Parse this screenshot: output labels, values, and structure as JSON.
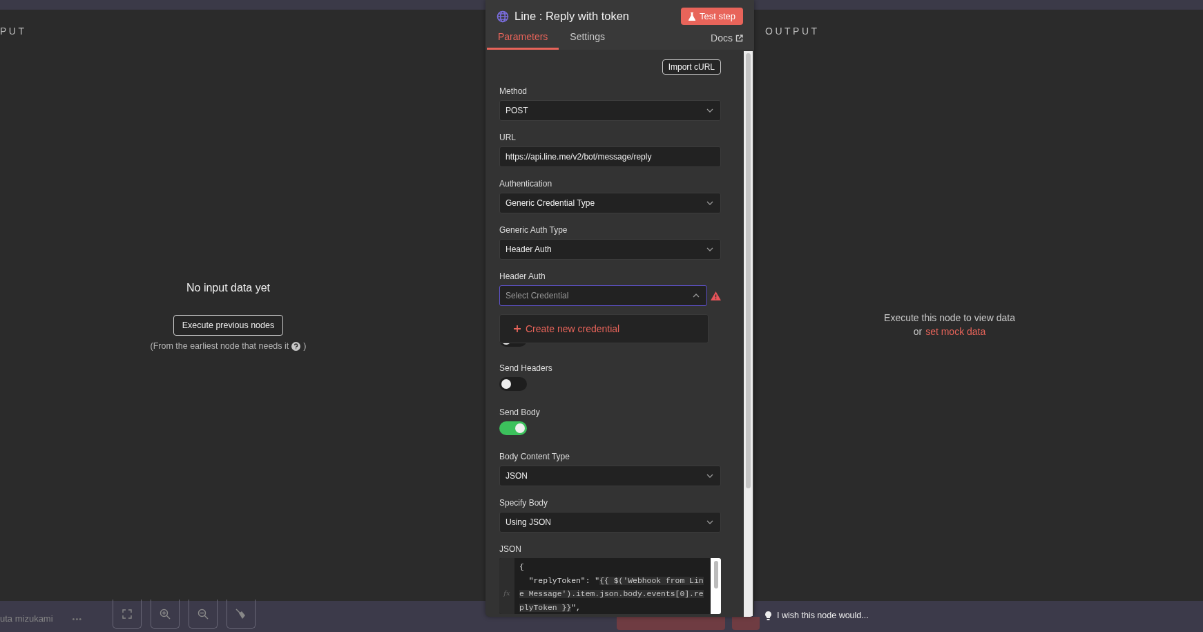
{
  "input_pane": {
    "title": "PUT",
    "message": "No input data yet",
    "button": "Execute previous nodes",
    "hint": "(From the earliest node that needs it",
    "hint_end": ")"
  },
  "node_panel": {
    "title": "Line : Reply with token",
    "test_button": "Test step",
    "tabs": [
      {
        "label": "Parameters",
        "selected": true
      },
      {
        "label": "Settings",
        "selected": false
      }
    ],
    "docs_link": "Docs",
    "import_button": "Import cURL",
    "fields": [
      {
        "kind": "select",
        "label": "Method",
        "value": "POST"
      },
      {
        "kind": "text",
        "label": "URL",
        "value": "https://api.line.me/v2/bot/message/reply"
      },
      {
        "kind": "select",
        "label": "Authentication",
        "value": "Generic Credential Type"
      },
      {
        "kind": "select",
        "label": "Generic Auth Type",
        "value": "Header Auth"
      },
      {
        "kind": "credential",
        "label": "Header Auth",
        "placeholder": "Select Credential",
        "expanded": true,
        "warning": true,
        "menu_item": "Create new credential"
      },
      {
        "kind": "toggle",
        "on": false
      },
      {
        "kind": "toggle",
        "label": "Send Headers",
        "on": false
      },
      {
        "kind": "toggle",
        "label": "Send Body",
        "on": true
      },
      {
        "kind": "select",
        "label": "Body Content Type",
        "value": "JSON"
      },
      {
        "kind": "select",
        "label": "Specify Body",
        "value": "Using JSON"
      },
      {
        "kind": "code",
        "label": "JSON",
        "gutter_label": "fx",
        "lines": [
          {
            "plain": "{"
          },
          {
            "plain": "  \"replyToken\": \"",
            "expr": "{{ $('Webhook from Lin"
          },
          {
            "expr": "e Message').item.json.body.events[0].re"
          },
          {
            "expr": "plyToken }}",
            "after": "\","
          }
        ]
      }
    ]
  },
  "output_pane": {
    "title": "OUTPUT",
    "message": "Execute this node to view data",
    "prefix": "or",
    "link": "set mock data"
  },
  "bottom_bar": {
    "user": "uta mizukami",
    "more": "•••",
    "feedback": "I wish this node would..."
  }
}
